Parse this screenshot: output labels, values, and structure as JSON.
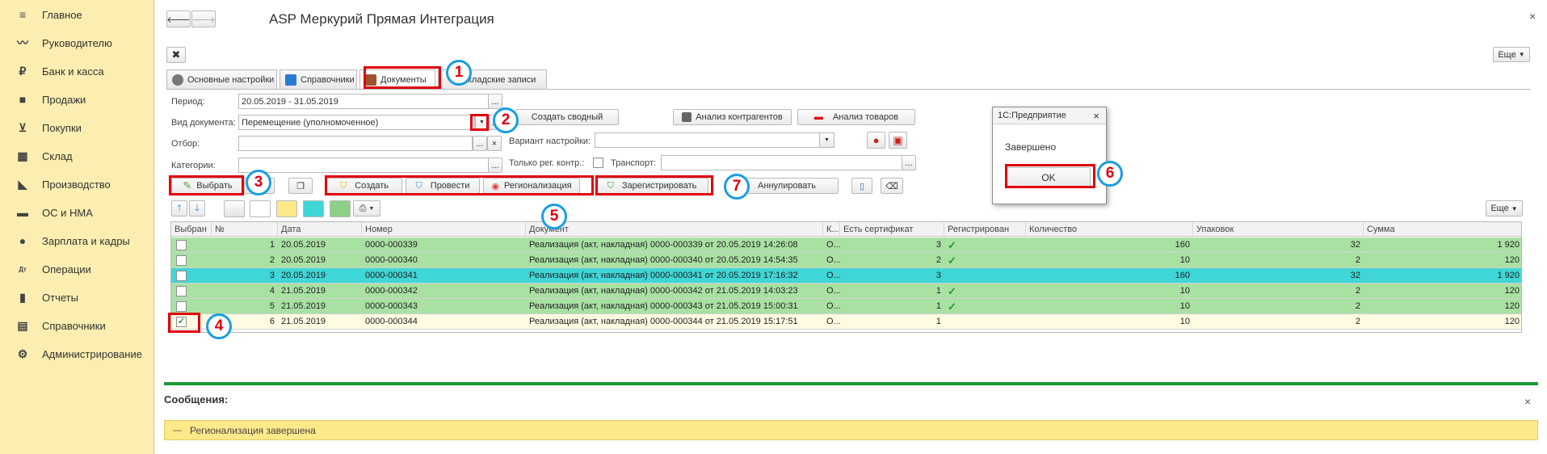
{
  "sidebar": {
    "items": [
      {
        "label": "Главное",
        "icon": "menu-icon"
      },
      {
        "label": "Руководителю",
        "icon": "chart-icon"
      },
      {
        "label": "Банк и касса",
        "icon": "ruble-icon"
      },
      {
        "label": "Продажи",
        "icon": "bag-icon"
      },
      {
        "label": "Покупки",
        "icon": "cart-icon"
      },
      {
        "label": "Склад",
        "icon": "warehouse-icon"
      },
      {
        "label": "Производство",
        "icon": "factory-icon"
      },
      {
        "label": "ОС и НМА",
        "icon": "truck-icon"
      },
      {
        "label": "Зарплата и кадры",
        "icon": "person-icon"
      },
      {
        "label": "Операции",
        "icon": "dt-kt-icon"
      },
      {
        "label": "Отчеты",
        "icon": "bar-chart-icon"
      },
      {
        "label": "Справочники",
        "icon": "books-icon"
      },
      {
        "label": "Администрирование",
        "icon": "gear-icon"
      }
    ]
  },
  "window": {
    "title": "ASP Меркурий Прямая Интеграция",
    "close": "×",
    "more_label": "Еще"
  },
  "tabs": [
    {
      "label": "Основные настройки"
    },
    {
      "label": "Справочники"
    },
    {
      "label": "Документы"
    },
    {
      "label": "кладские записи"
    }
  ],
  "form": {
    "period_label": "Период:",
    "period_value": "20.05.2019 - 31.05.2019",
    "doctype_label": "Вид документа:",
    "doctype_value": "Перемещение (уполномоченное)",
    "filter_label": "Отбор:",
    "category_label": "Категории:",
    "create_summary": "Создать сводный",
    "analysis_contractors": "Анализ контрагентов",
    "analysis_goods": "Анализ товаров",
    "variant_label": "Вариант настройки:",
    "only_reg_label": "Только рег. контр.:",
    "transport_label": "Транспорт:"
  },
  "toolbar": {
    "select": "Выбрать",
    "create": "Создать",
    "post": "Провести",
    "regionalization": "Регионализация",
    "register": "Зарегистрировать",
    "cancel": "Аннулировать",
    "more": "Еще"
  },
  "table": {
    "columns": [
      "Выбран",
      "№",
      "Дата",
      "Номер",
      "Документ",
      "К...",
      "Есть сертификат",
      "Регистрирован",
      "Количество",
      "Упаковок",
      "Сумма"
    ],
    "rows": [
      {
        "n": "1",
        "date": "20.05.2019",
        "num": "0000-000339",
        "doc": "Реализация (акт, накладная) 0000-000339 от 20.05.2019 14:26:08",
        "k": "О...",
        "cert": "3",
        "reg": "✓",
        "qty": "160",
        "pack": "32",
        "sum": "1 920",
        "checked": "",
        "bg": "#a9e1a3"
      },
      {
        "n": "2",
        "date": "20.05.2019",
        "num": "0000-000340",
        "doc": "Реализация (акт, накладная) 0000-000340 от 20.05.2019 14:54:35",
        "k": "О...",
        "cert": "2",
        "reg": "✓",
        "qty": "10",
        "pack": "2",
        "sum": "120",
        "checked": "",
        "bg": "#a9e1a3"
      },
      {
        "n": "3",
        "date": "20.05.2019",
        "num": "0000-000341",
        "doc": "Реализация (акт, накладная) 0000-000341 от 20.05.2019 17:16:32",
        "k": "О...",
        "cert": "3",
        "reg": "",
        "qty": "160",
        "pack": "32",
        "sum": "1 920",
        "checked": "",
        "bg": "#3ed6d6"
      },
      {
        "n": "4",
        "date": "21.05.2019",
        "num": "0000-000342",
        "doc": "Реализация (акт, накладная) 0000-000342 от 21.05.2019 14:03:23",
        "k": "О...",
        "cert": "1",
        "reg": "✓",
        "qty": "10",
        "pack": "2",
        "sum": "120",
        "checked": "",
        "bg": "#a9e1a3"
      },
      {
        "n": "5",
        "date": "21.05.2019",
        "num": "0000-000343",
        "doc": "Реализация (акт, накладная) 0000-000343 от 21.05.2019 15:00:31",
        "k": "О...",
        "cert": "1",
        "reg": "✓",
        "qty": "10",
        "pack": "2",
        "sum": "120",
        "checked": "",
        "bg": "#a9e1a3"
      },
      {
        "n": "6",
        "date": "21.05.2019",
        "num": "0000-000344",
        "doc": "Реализация (акт, накладная) 0000-000344 от 21.05.2019 15:17:51",
        "k": "О...",
        "cert": "1",
        "reg": "",
        "qty": "10",
        "pack": "2",
        "sum": "120",
        "checked": "✓",
        "bg": "#fffbe3"
      }
    ]
  },
  "messages": {
    "title": "Сообщения:",
    "text": "Регионализация завершена",
    "close": "×"
  },
  "dialog": {
    "title": "1С:Предприятие",
    "text": "Завершено",
    "ok": "OK",
    "close": "×"
  },
  "callouts": [
    "1",
    "2",
    "3",
    "4",
    "5",
    "6",
    "7"
  ],
  "colors": {
    "sidebar": "#fbeeb0",
    "registered_row": "#a9e1a3",
    "selected_row": "#3ed6d6",
    "annotation_red": "#e0000d",
    "annotation_blue": "#1b9de2"
  }
}
